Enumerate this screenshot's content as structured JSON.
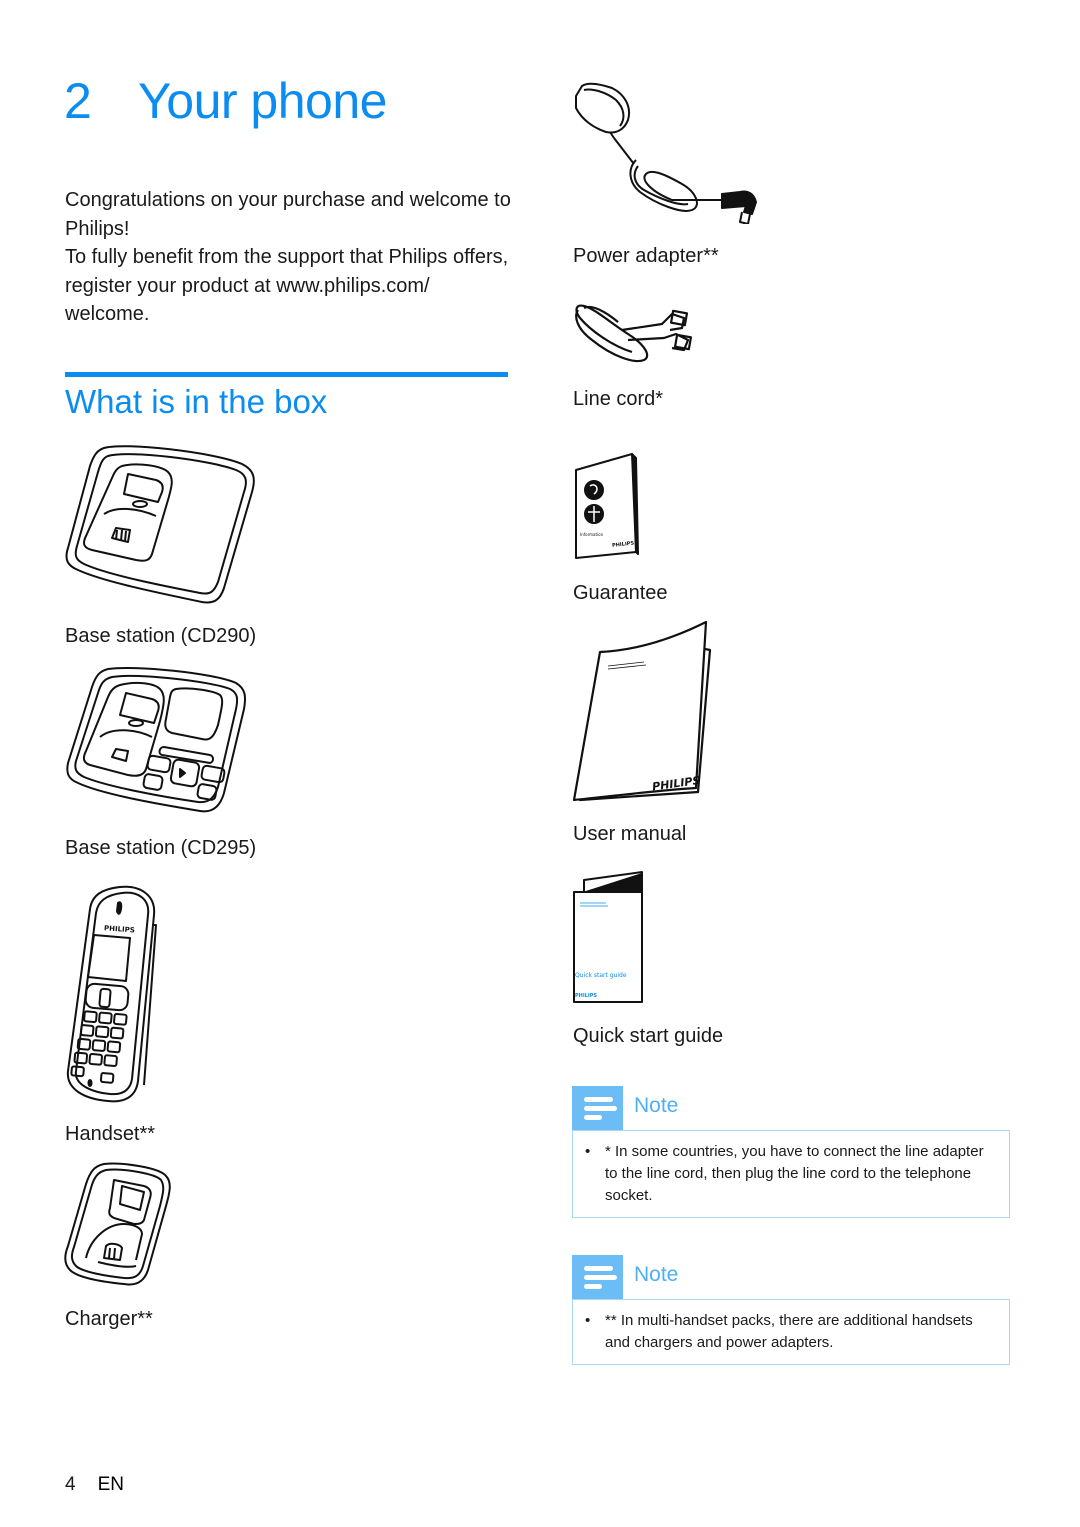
{
  "chapter": {
    "number": "2",
    "title": "Your phone"
  },
  "intro": {
    "paragraphs": [
      "Congratulations on your purchase and welcome to Philips!",
      "To fully benefit from the support that Philips offers, register your product at www.philips.com/ welcome."
    ]
  },
  "section": {
    "title": "What is in the box"
  },
  "box_items_left": [
    {
      "label": "Base station (CD290)",
      "icon": "base-station-cd290-illustration"
    },
    {
      "label": "Base station (CD295)",
      "icon": "base-station-cd295-illustration"
    },
    {
      "label": "Handset**",
      "icon": "handset-illustration"
    },
    {
      "label": "Charger**",
      "icon": "charger-illustration"
    }
  ],
  "box_items_right": [
    {
      "label": "Power adapter**",
      "icon": "power-adapter-illustration"
    },
    {
      "label": "Line cord*",
      "icon": "line-cord-illustration"
    },
    {
      "label": "Guarantee",
      "icon": "guarantee-booklet-illustration"
    },
    {
      "label": "User manual",
      "icon": "user-manual-illustration"
    },
    {
      "label": "Quick start guide",
      "icon": "quick-start-guide-illustration"
    }
  ],
  "illustration_text": {
    "handset_brand": "PHILIPS",
    "manual_brand": "PHILIPS",
    "guarantee_brand": "PHILIPS",
    "guarantee_caption": "Information",
    "qsg_title": "Quick start guide",
    "qsg_brand": "PHILIPS"
  },
  "notes": [
    {
      "title": "Note",
      "icon": "note-icon",
      "bullets": [
        "* In some countries, you have to connect the line adapter to the line cord, then plug the line cord to the telephone socket."
      ]
    },
    {
      "title": "Note",
      "icon": "note-icon",
      "bullets": [
        "** In multi-handset packs, there are additional handsets and chargers and power adapters."
      ]
    }
  ],
  "footer": {
    "page_number": "4",
    "language": "EN"
  },
  "colors": {
    "accent": "#0a8cf0",
    "note_icon_bg": "#6cbcf5",
    "note_title": "#4eb0f2",
    "note_border": "#a9d8f7",
    "text": "#1a1a1a"
  }
}
